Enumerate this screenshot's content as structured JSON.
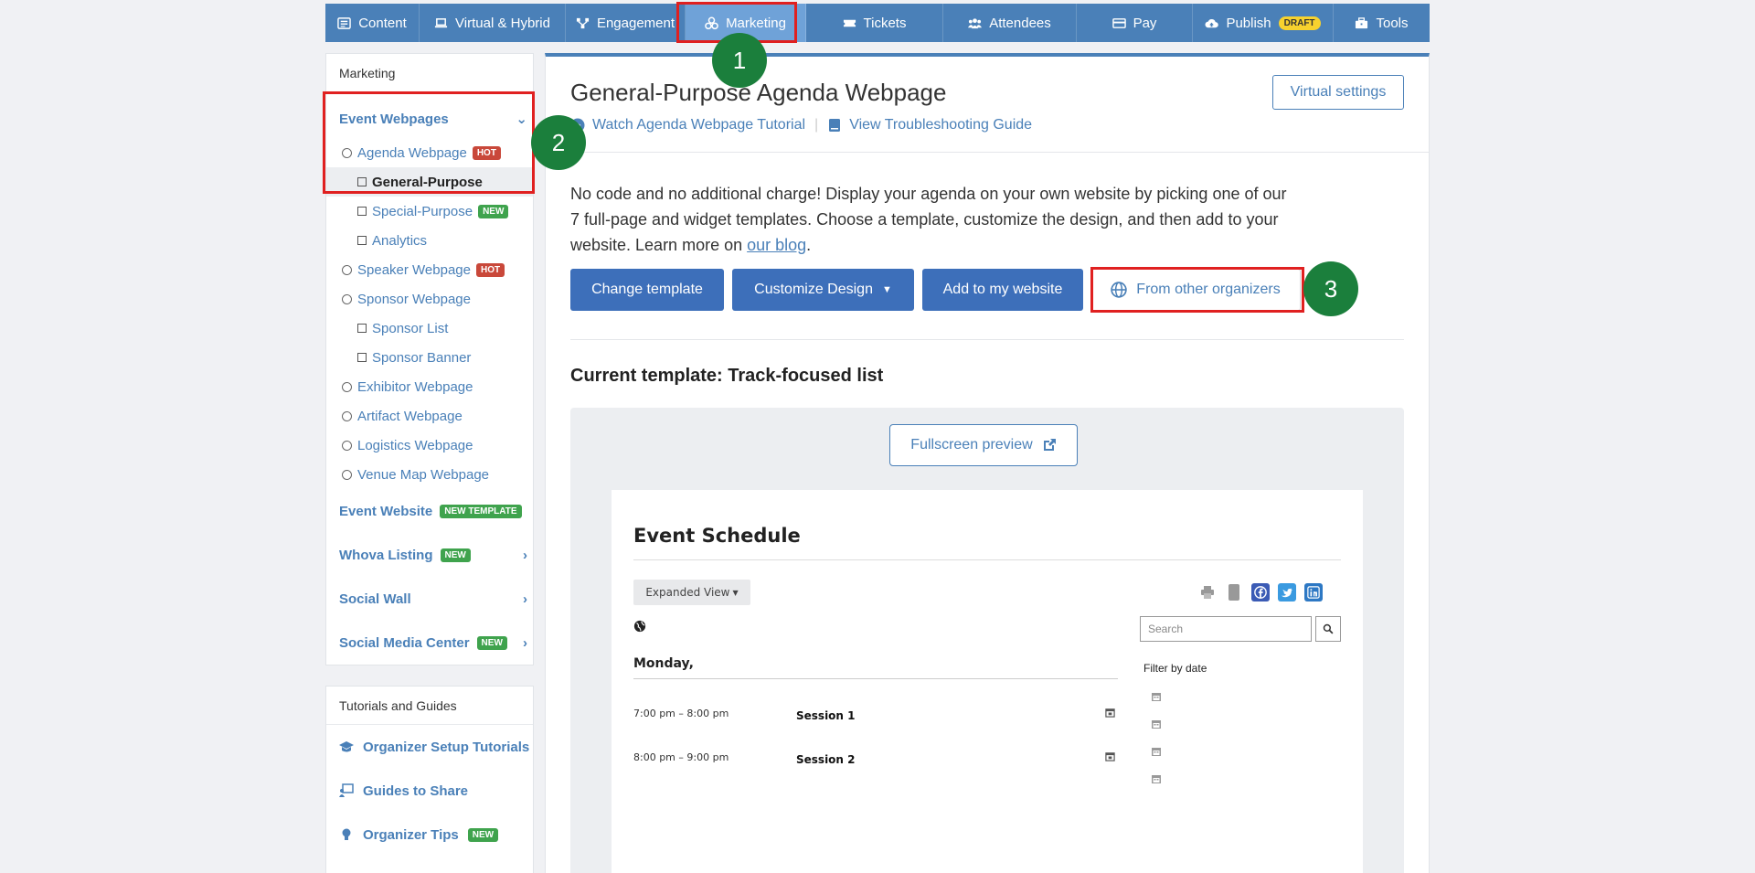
{
  "nav": {
    "tabs": [
      {
        "label": "Content",
        "icon": "list-icon"
      },
      {
        "label": "Virtual & Hybrid",
        "icon": "laptop-icon"
      },
      {
        "label": "Engagement",
        "icon": "network-icon"
      },
      {
        "label": "Marketing",
        "icon": "marketing-icon"
      },
      {
        "label": "Tickets",
        "icon": "ticket-icon"
      },
      {
        "label": "Attendees",
        "icon": "users-icon"
      },
      {
        "label": "Pay",
        "icon": "card-icon"
      },
      {
        "label": "Publish",
        "icon": "cloud-upload-icon",
        "badge": "DRAFT"
      },
      {
        "label": "Tools",
        "icon": "toolbox-icon"
      }
    ]
  },
  "sidebar": {
    "header": "Marketing",
    "event_webpages": "Event Webpages",
    "items": [
      {
        "label": "Agenda Webpage",
        "tag": "HOT"
      },
      {
        "label": "General-Purpose"
      },
      {
        "label": "Special-Purpose",
        "tag": "NEW"
      },
      {
        "label": "Analytics"
      },
      {
        "label": "Speaker Webpage",
        "tag": "HOT"
      },
      {
        "label": "Sponsor Webpage"
      },
      {
        "label": "Sponsor List"
      },
      {
        "label": "Sponsor Banner"
      },
      {
        "label": "Exhibitor Webpage"
      },
      {
        "label": "Artifact Webpage"
      },
      {
        "label": "Logistics Webpage"
      },
      {
        "label": "Venue Map Webpage"
      }
    ],
    "event_website": "Event Website",
    "event_website_tag": "NEW TEMPLATE",
    "whova_listing": "Whova Listing",
    "whova_listing_tag": "NEW",
    "social_wall": "Social Wall",
    "social_media_center": "Social Media Center",
    "social_media_center_tag": "NEW"
  },
  "guides": {
    "header": "Tutorials and Guides",
    "items": [
      {
        "label": "Organizer Setup Tutorials"
      },
      {
        "label": "Guides to Share"
      },
      {
        "label": "Organizer Tips",
        "tag": "NEW"
      }
    ]
  },
  "main": {
    "title": "General-Purpose Agenda Webpage",
    "watch_link": "Watch Agenda Webpage Tutorial",
    "guide_link": "View Troubleshooting Guide",
    "separator": "|",
    "virtual_settings": "Virtual settings",
    "desc_text": "No code and no additional charge! Display your agenda on your own website by picking one of our 7 full-page and widget templates. Choose a template, customize the design, and then add to your website. Learn more on ",
    "desc_link": "our blog",
    "desc_end": ".",
    "buttons": {
      "change_template": "Change template",
      "customize_design": "Customize Design",
      "add_to_website": "Add to my website",
      "from_other": "From other organizers"
    },
    "current_template": "Current template: Track-focused list",
    "fullscreen": "Fullscreen preview"
  },
  "preview": {
    "title": "Event Schedule",
    "view": "Expanded View",
    "search_placeholder": "Search",
    "day": "Monday,",
    "filter": "Filter by date",
    "sessions": [
      {
        "time": "7:00 pm – 8:00 pm",
        "name": "Session 1"
      },
      {
        "time": "8:00 pm – 9:00 pm",
        "name": "Session 2"
      }
    ]
  },
  "annotations": {
    "m1": "1",
    "m2": "2",
    "m3": "3"
  },
  "colors": {
    "primary": "#4a80b8",
    "button": "#3d6fba",
    "highlight": "#e02020",
    "marker": "#1b7f3c"
  }
}
